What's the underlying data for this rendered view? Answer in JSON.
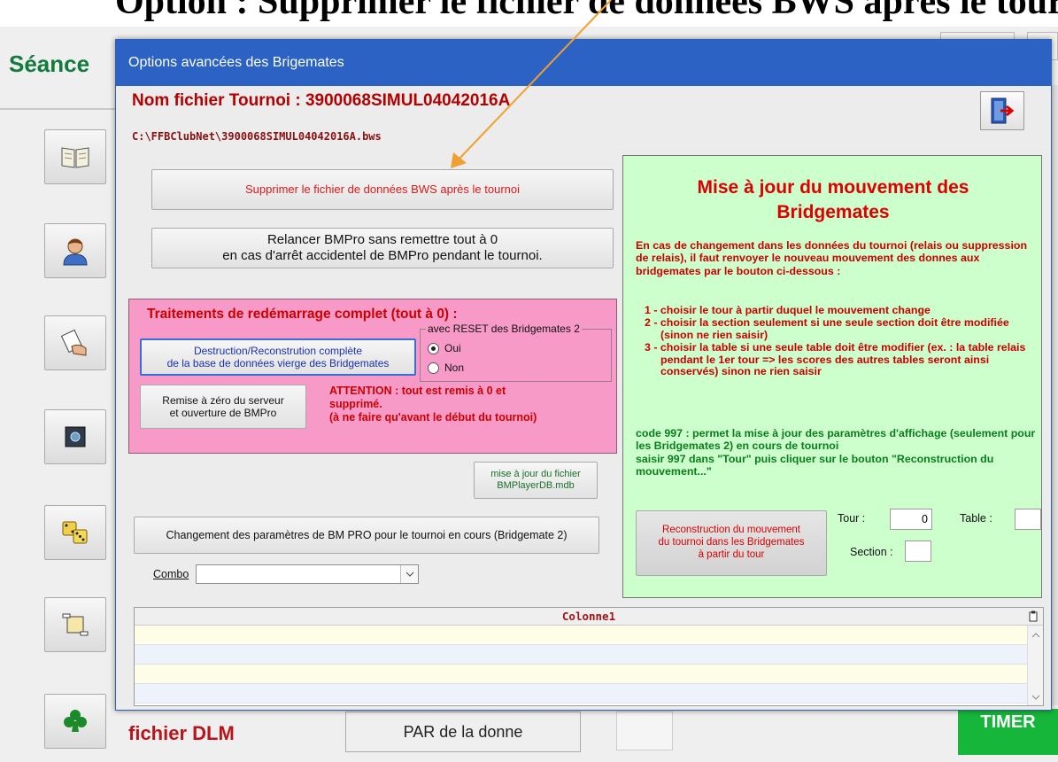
{
  "caption": "Option : Supprimer le fichier de données BWS après le tournoi",
  "background": {
    "title": "Séance",
    "dlm_label": "fichier DLM",
    "par_button": "PAR de la donne",
    "timer_button": "TIMER"
  },
  "dialog": {
    "title": "Options avancées des Brigemates",
    "tournament_label": "Nom fichier Tournoi : 3900068SIMUL04042016A",
    "file_path": "C:\\FFBClubNet\\3900068SIMUL04042016A.bws",
    "exit_icon": "exit-door-icon",
    "supprimer_button": "Supprimer le fichier de données BWS après le tournoi",
    "relancer_line1": "Relancer BMPro sans remettre tout à 0",
    "relancer_line2": "en cas d'arrêt accidentel de BMPro pendant le tournoi.",
    "restart_panel": {
      "title": "Traitements de redémarrage complet (tout à 0) :",
      "destruction_line1": "Destruction/Reconstrution complète",
      "destruction_line2": "de la base de données vierge des Bridgemates",
      "reset_legend": "avec RESET des Bridgemates 2",
      "oui": "Oui",
      "non": "Non",
      "remise_line1": "Remise à zéro du serveur",
      "remise_line2": "et ouverture de BMPro",
      "attention_line1": "ATTENTION : tout est remis à 0 et",
      "attention_line2": "supprimé.",
      "attention_line3": "(à ne faire qu'avant le début du tournoi)"
    },
    "maj_line1": "mise à jour du fichier",
    "maj_line2": "BMPlayerDB.mdb",
    "changement_button": "Changement des paramètres de BM PRO pour le tournoi en cours (Bridgemate 2)",
    "combo_label": "Combo",
    "combo_value": "",
    "movement_panel": {
      "title_line1": "Mise à jour du mouvement des",
      "title_line2": "Bridgemates",
      "intro": "En cas de changement dans les données du tournoi (relais ou suppression de relais), il faut renvoyer le nouveau mouvement des donnes aux bridgemates par le bouton ci-dessous :",
      "step1": "1 - choisir le tour à partir duquel le mouvement change",
      "step2": "2 - choisir la section seulement si une seule section doit être modifiée (sinon ne rien saisir)",
      "step3": "3 - choisir la table si une seule table doit être modifier (ex. : la table relais pendant le 1er tour => les scores des autres tables seront ainsi conservés) sinon ne rien saisir",
      "code_text": "code 997 : permet la mise à jour des paramètres d'affichage (seulement pour les Bridgemates 2) en cours de tournoi",
      "code_text2": "saisir 997 dans \"Tour\" puis cliquer sur le bouton \"Reconstruction du mouvement...\"",
      "recon_line1": "Reconstruction du mouvement",
      "recon_line2": "du tournoi dans les Bridgemates",
      "recon_line3": "à partir du tour",
      "tour_label": "Tour :",
      "tour_value": "0",
      "table_label": "Table :",
      "table_value": "",
      "section_label": "Section :",
      "section_value": ""
    },
    "grid": {
      "column": "Colonne1",
      "rows": [
        "",
        "",
        "",
        ""
      ]
    }
  },
  "colors": {
    "titlebar": "#2b62c3",
    "red_text": "#cc0000",
    "pink_panel": "#f79ac8",
    "green_panel": "#ccffcc",
    "green_text": "#0a7d1c"
  }
}
